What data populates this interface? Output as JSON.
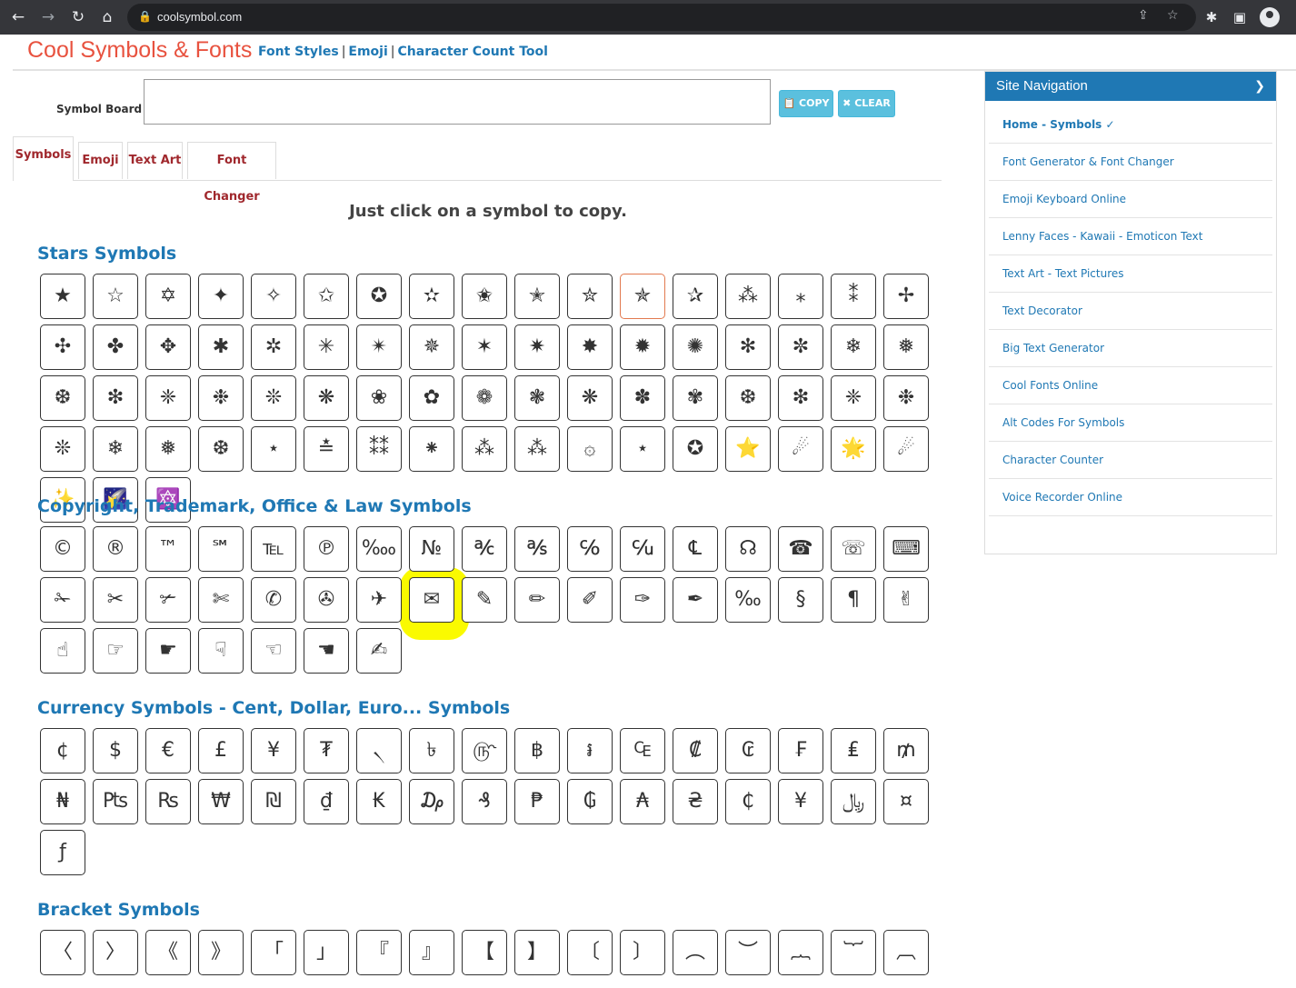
{
  "browser": {
    "url": "coolsymbol.com",
    "icons": [
      "back-icon",
      "forward-icon",
      "reload-icon",
      "home-icon"
    ]
  },
  "header": {
    "logo": "Cool Symbols & Fonts",
    "nav": [
      "Font Styles",
      "Emoji",
      "Character Count Tool"
    ]
  },
  "board": {
    "label": "Symbol Board",
    "copy_label": "📋 COPY",
    "clear_label": "✖ CLEAR"
  },
  "tabs": [
    "Symbols",
    "Emoji",
    "Text Art",
    "Font Changer"
  ],
  "instruction": "Just click on a symbol to copy.",
  "sections": {
    "stars": {
      "title": "Stars Symbols",
      "symbols": [
        "★",
        "☆",
        "✡",
        "✦",
        "✧",
        "✩",
        "✪",
        "✫",
        "✬",
        "✭",
        "✮",
        "✯",
        "✰",
        "⁂",
        "⁎",
        "⁑",
        "✢",
        "✣",
        "✤",
        "✥",
        "✱",
        "✲",
        "✳",
        "✴",
        "✵",
        "✶",
        "✷",
        "✸",
        "✹",
        "✺",
        "✻",
        "✼",
        "❄",
        "❅",
        "❆",
        "❇",
        "❈",
        "❉",
        "❊",
        "❋",
        "❀",
        "✿",
        "❁",
        "❃",
        "❋",
        "✽",
        "✾",
        "❆",
        "❇",
        "❈",
        "❉",
        "❊",
        "❄",
        "❅",
        "❆",
        "⋆",
        "≛",
        "⁑⁑",
        "⁕",
        "⁂",
        "⁂",
        "۞",
        "⋆",
        "✪",
        "⭐",
        "☄",
        "🌟",
        "☄",
        "✨",
        "🌠",
        "🔯"
      ]
    },
    "office": {
      "title": "Copyright, Trademark, Office & Law Symbols",
      "symbols": [
        "©",
        "®",
        "™",
        "℠",
        "℡",
        "℗",
        "‱",
        "№",
        "℀",
        "℁",
        "℅",
        "℆",
        "℄",
        "☊",
        "☎",
        "☏",
        "⌨",
        "✁",
        "✂",
        "✃",
        "✄",
        "✆",
        "✇",
        "✈",
        "✉",
        "✎",
        "✏",
        "✐",
        "✑",
        "✒",
        "‰",
        "§",
        "¶",
        "✌",
        "☝",
        "☞",
        "☛",
        "☟",
        "☜",
        "☚",
        "✍"
      ]
    },
    "currency": {
      "title": "Currency Symbols - Cent, Dollar, Euro... Symbols",
      "symbols": [
        "¢",
        "$",
        "€",
        "£",
        "¥",
        "₮",
        "৲",
        "৳",
        "௹",
        "฿",
        "៛",
        "₠",
        "₡",
        "₢",
        "₣",
        "₤",
        "₥",
        "₦",
        "₧",
        "₨",
        "₩",
        "₪",
        "₫",
        "₭",
        "₯",
        "₰",
        "₱",
        "₲",
        "₳",
        "₴",
        "₵",
        "¥",
        "﷼",
        "¤",
        "ƒ"
      ]
    },
    "bracket": {
      "title": "Bracket Symbols",
      "symbols": [
        "〈",
        "〉",
        "《",
        "》",
        "「",
        "」",
        "『",
        "』",
        "【",
        "】",
        "〔",
        "〕",
        "︵",
        "︶",
        "︷",
        "︸",
        "︹"
      ]
    }
  },
  "sidebar": {
    "title": "Site Navigation",
    "items": [
      "Home - Symbols ✓",
      "Font Generator & Font Changer",
      "Emoji Keyboard Online",
      "Lenny Faces - Kawaii - Emoticon Text",
      "Text Art - Text Pictures",
      "Text Decorator",
      "Big Text Generator",
      "Cool Fonts Online",
      "Alt Codes For Symbols",
      "Character Counter",
      "Voice Recorder Online"
    ]
  }
}
